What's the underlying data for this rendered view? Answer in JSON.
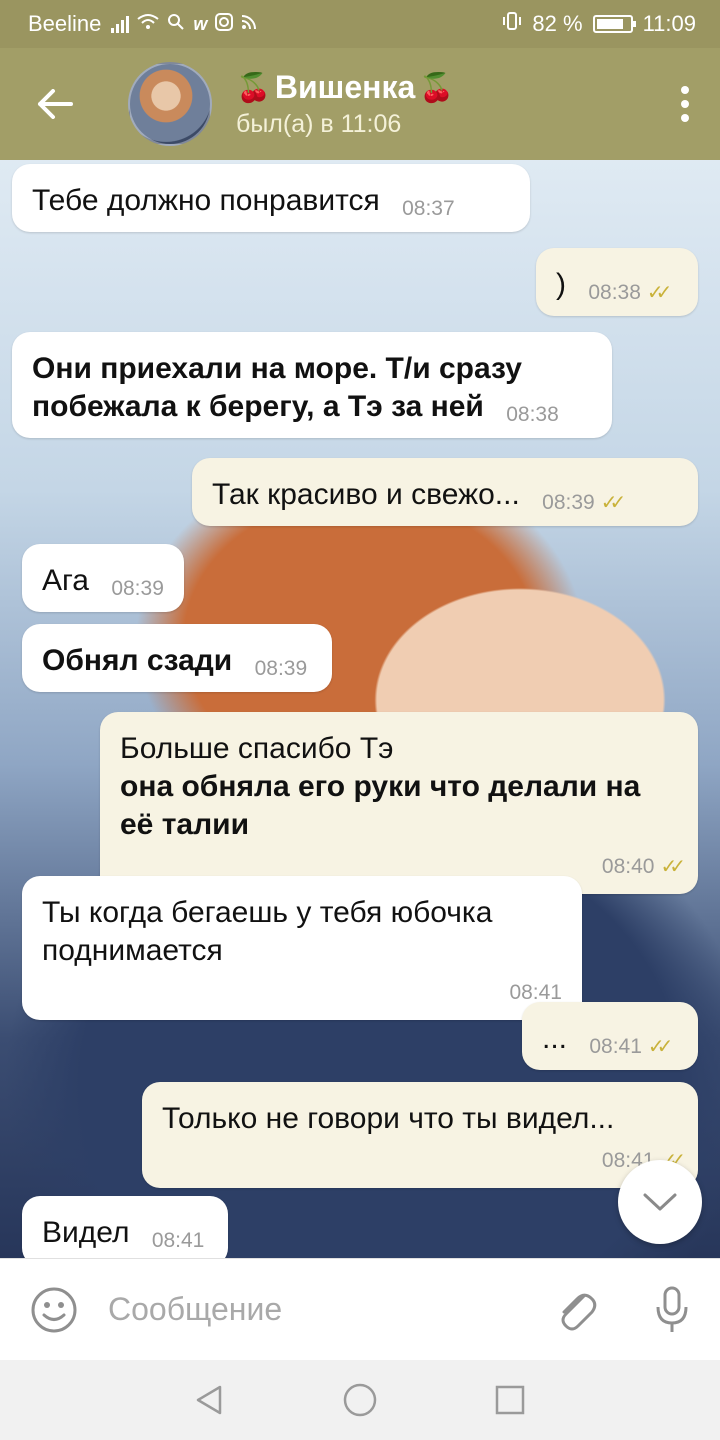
{
  "status_bar": {
    "carrier": "Beeline",
    "battery": "82 %",
    "battery_level": 0.82,
    "time": "11:09"
  },
  "header": {
    "title": "Вишенка",
    "title_icon": "cherry-icon",
    "subtitle": "был(а) в 11:06"
  },
  "messages": [
    {
      "direction": "in",
      "text": "Тебе должно понравится",
      "time": "08:37"
    },
    {
      "direction": "out",
      "text": ")",
      "time": "08:38",
      "read": true
    },
    {
      "direction": "in",
      "text": "Они приехали на море. Т/и сразу побежала к берегу, а Тэ за ней",
      "time": "08:38",
      "bold": true
    },
    {
      "direction": "out",
      "text": "Так красиво и свежо...",
      "time": "08:39",
      "read": true
    },
    {
      "direction": "in",
      "text": "Ага",
      "time": "08:39"
    },
    {
      "direction": "in",
      "text": "Обнял сзади",
      "time": "08:39",
      "bold": true
    },
    {
      "direction": "out",
      "text": "Больше спасибо Тэ",
      "text_bold": "она обняла его руки что делали на её талии",
      "time": "08:40",
      "read": true
    },
    {
      "direction": "in",
      "text": "Ты когда бегаешь у тебя юбочка поднимается",
      "time": "08:41"
    },
    {
      "direction": "out",
      "text": "...",
      "time": "08:41",
      "read": true
    },
    {
      "direction": "out",
      "text": "Только не говори что ты видел...",
      "time": "08:41",
      "read": true
    },
    {
      "direction": "in",
      "text": "Видел",
      "time": "08:41"
    }
  ],
  "input": {
    "placeholder": "Сообщение"
  },
  "colors": {
    "header": "#a29e67",
    "status_bar": "#9a9560",
    "incoming_bubble": "#ffffff",
    "outgoing_bubble": "#f7f3e3",
    "read_check": "#c9b23a"
  }
}
